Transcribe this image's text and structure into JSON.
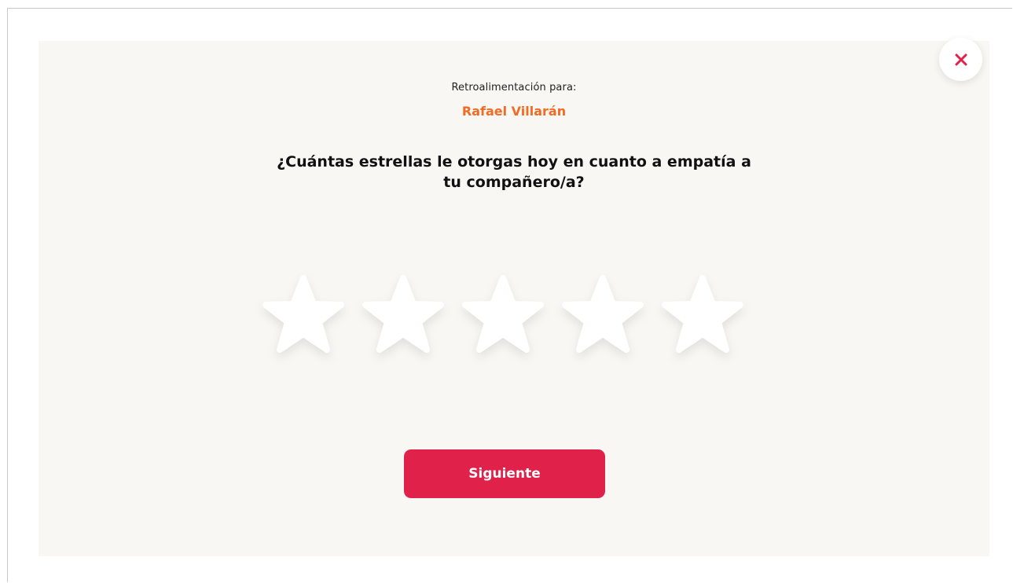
{
  "feedback": {
    "subtitle": "Retroalimentación para:",
    "recipient_name": "Rafael Villarán",
    "question": "¿Cuántas estrellas le otorgas hoy en cuanto a empatía a tu compañero/a?"
  },
  "rating": {
    "max_stars": 5,
    "selected": 0
  },
  "actions": {
    "next_label": "Siguiente",
    "close_icon": "close-icon"
  },
  "colors": {
    "accent": "#e0224a",
    "name": "#f26b25",
    "panel_background": "#f9f7f3",
    "star_fill": "#ffffff"
  }
}
